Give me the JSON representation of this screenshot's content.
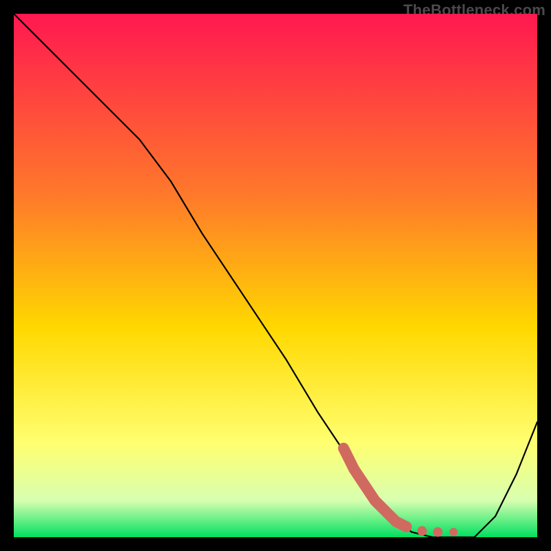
{
  "watermark": "TheBottleneck.com",
  "chart_data": {
    "type": "line",
    "title": "",
    "xlabel": "",
    "ylabel": "",
    "xlim": [
      0,
      100
    ],
    "ylim": [
      0,
      100
    ],
    "grid": false,
    "legend": false,
    "background_gradient": {
      "top": "#ff1850",
      "mid_upper": "#ff7a2a",
      "mid": "#ffd800",
      "mid_lower": "#ffff70",
      "low": "#d8ffb0",
      "bottom": "#00e060"
    },
    "series": [
      {
        "name": "curve",
        "stroke": "#000000",
        "x": [
          0,
          8,
          16,
          24,
          30,
          36,
          44,
          52,
          58,
          64,
          68,
          72,
          76,
          80,
          84,
          88,
          92,
          96,
          100
        ],
        "y": [
          100,
          92,
          84,
          76,
          68,
          58,
          46,
          34,
          24,
          15,
          10,
          4,
          1,
          0,
          0,
          0,
          4,
          12,
          22
        ]
      }
    ],
    "highlight": {
      "name": "dots",
      "stroke": "#d06a60",
      "points": [
        {
          "x": 63,
          "y": 17
        },
        {
          "x": 65,
          "y": 13
        },
        {
          "x": 67,
          "y": 10
        },
        {
          "x": 69,
          "y": 7
        },
        {
          "x": 71,
          "y": 5
        },
        {
          "x": 73,
          "y": 3
        },
        {
          "x": 75,
          "y": 2
        },
        {
          "x": 78,
          "y": 1.2
        },
        {
          "x": 81,
          "y": 1.0
        },
        {
          "x": 84,
          "y": 1.0
        }
      ]
    }
  }
}
